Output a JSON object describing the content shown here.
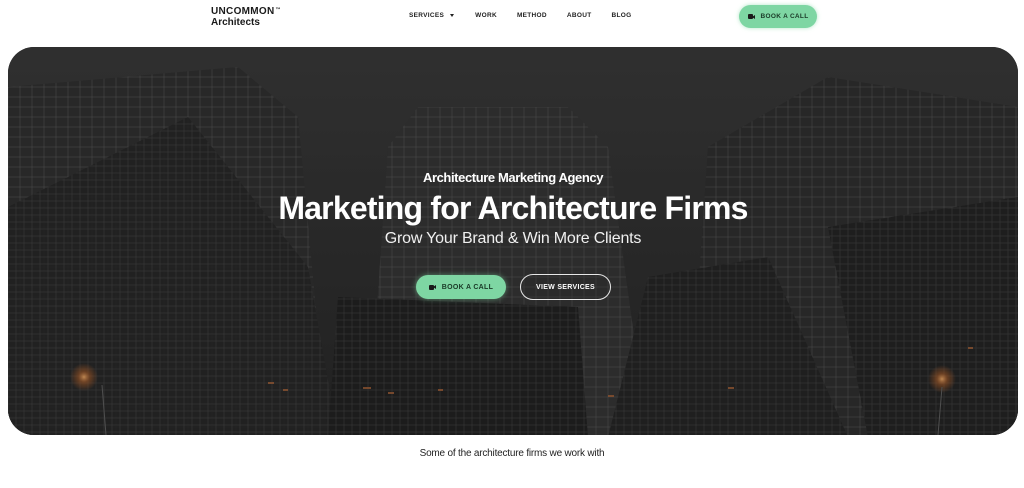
{
  "header": {
    "logo_line1": "UNCOMMON",
    "logo_tm": "™",
    "logo_line2": "Architects",
    "nav": [
      {
        "label": "SERVICES",
        "has_dropdown": true
      },
      {
        "label": "WORK"
      },
      {
        "label": "METHOD"
      },
      {
        "label": "ABOUT"
      },
      {
        "label": "BLOG"
      }
    ],
    "cta_label": "BOOK A CALL"
  },
  "hero": {
    "eyebrow": "Architecture Marketing Agency",
    "title": "Marketing for Architecture Firms",
    "subtitle": "Grow Your Brand & Win More Clients",
    "primary_button": "BOOK A CALL",
    "secondary_button": "VIEW SERVICES"
  },
  "clients": {
    "intro": "Some of the architecture firms we work with"
  },
  "colors": {
    "accent": "#7ed6a3",
    "hero_dark": "#2c2c2c",
    "text": "#1a1a1a"
  },
  "icons": {
    "video_camera": "video-camera-icon",
    "dropdown": "chevron-down-icon"
  }
}
